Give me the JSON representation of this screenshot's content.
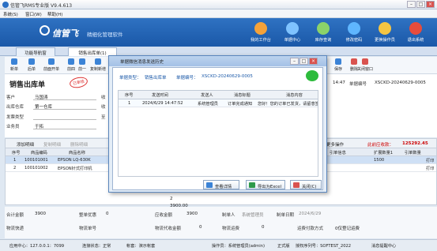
{
  "app": {
    "title": "信管飞RMS专业版 V9.4.613"
  },
  "menu": [
    "系统(S)",
    "窗口(W)",
    "帮助(H)"
  ],
  "banner": {
    "logo": "信管飞",
    "slogan": "精细化管理软件"
  },
  "nav": [
    {
      "label": "我的工作台",
      "color": "#f4a23a"
    },
    {
      "label": "单据中心",
      "color": "#7fc3ff"
    },
    {
      "label": "库存查询",
      "color": "#8bd36a"
    },
    {
      "label": "修改密码",
      "color": "#5fb6ff"
    },
    {
      "label": "更换操作员",
      "color": "#f5c542"
    },
    {
      "label": "退出系统",
      "color": "#e74c3c"
    }
  ],
  "tabs": [
    "功能导航窗",
    "销售出库单(1)"
  ],
  "toolbar": [
    "新单",
    "后单",
    "前面开单",
    "前四",
    "前一",
    "复制新增",
    "保存",
    "删除",
    "关闭窗口"
  ],
  "form": {
    "title": "销售出库单",
    "stamp": "已审核",
    "customer_label": "客户",
    "customer": "马国涛",
    "warehouse_label": "出库仓库",
    "warehouse": "第一仓库",
    "invoice_label": "发票类型",
    "invoice": "",
    "salesman_label": "业务员",
    "salesman": "于拓",
    "col2a": "收",
    "col2b": "收",
    "col2c": "至",
    "date": "14:47",
    "bill_label": "单据编号",
    "bill": "XSCKD-20240629-0005"
  },
  "gridbar": {
    "add": "添加明细",
    "copy": "复制明细",
    "del": "删除明细",
    "more": "更多操作",
    "total_label": "此前应收款：",
    "total": "125292.45"
  },
  "grid": {
    "headers": [
      "序号",
      "商品编码",
      "商品名称",
      "引单信息",
      "扩展数量1",
      "引单数量"
    ],
    "rows": [
      {
        "no": "1",
        "code": "100101001",
        "name": "EPSON LQ-630K",
        "ext": "1500",
        "act": "打印"
      },
      {
        "no": "2",
        "code": "100101002",
        "name": "EPSON针式打印机",
        "ext": "",
        "act": "打印"
      }
    ],
    "footer_qty": "2",
    "footer_amt": "3900.00"
  },
  "summary": {
    "total_label": "合计金额",
    "total": "3900",
    "discount_label": "整单优惠",
    "discount": "0",
    "receivable_label": "应收金额",
    "receivable": "3900",
    "maker_label": "制单人",
    "maker": "系统管理员",
    "date_label": "制单日期",
    "date": "2024/6/29",
    "ship_label": "物流快递",
    "ship_no_label": "物流单号",
    "cod_label": "物流代收金额",
    "cod": "0",
    "fee_label": "物流运费",
    "fee": "0",
    "pay_label": "运费付款方式",
    "pay": "0仅登记运费"
  },
  "status": {
    "center": "应用中心：127.0.0.1：7099",
    "conn": "连接状态：正常",
    "acc": "帐套：演示帐套",
    "user": "操作员：系统管理员(admin)",
    "ver": "正式版",
    "license": "授权序列号：SOFTEST_2022",
    "msg": "消息提醒中心"
  },
  "dialog": {
    "title": "单据微信消息发送历史",
    "type_label": "单据类型：",
    "type": "销售出库单",
    "no_label": "单据编号：",
    "no": "XSCKD-20240629-0005",
    "headers": [
      "序号",
      "发送时间",
      "发送人",
      "消息标题",
      "消息内容"
    ],
    "row": {
      "no": "1",
      "time": "2024/6/29 14:47:52",
      "sender": "系统管理员",
      "subject": "订单完成通知",
      "content": "您好！您的订单已发货，请留意签收"
    },
    "buttons": {
      "view": "查看详情",
      "export": "导出为Excel",
      "close": "关闭(C)"
    }
  }
}
